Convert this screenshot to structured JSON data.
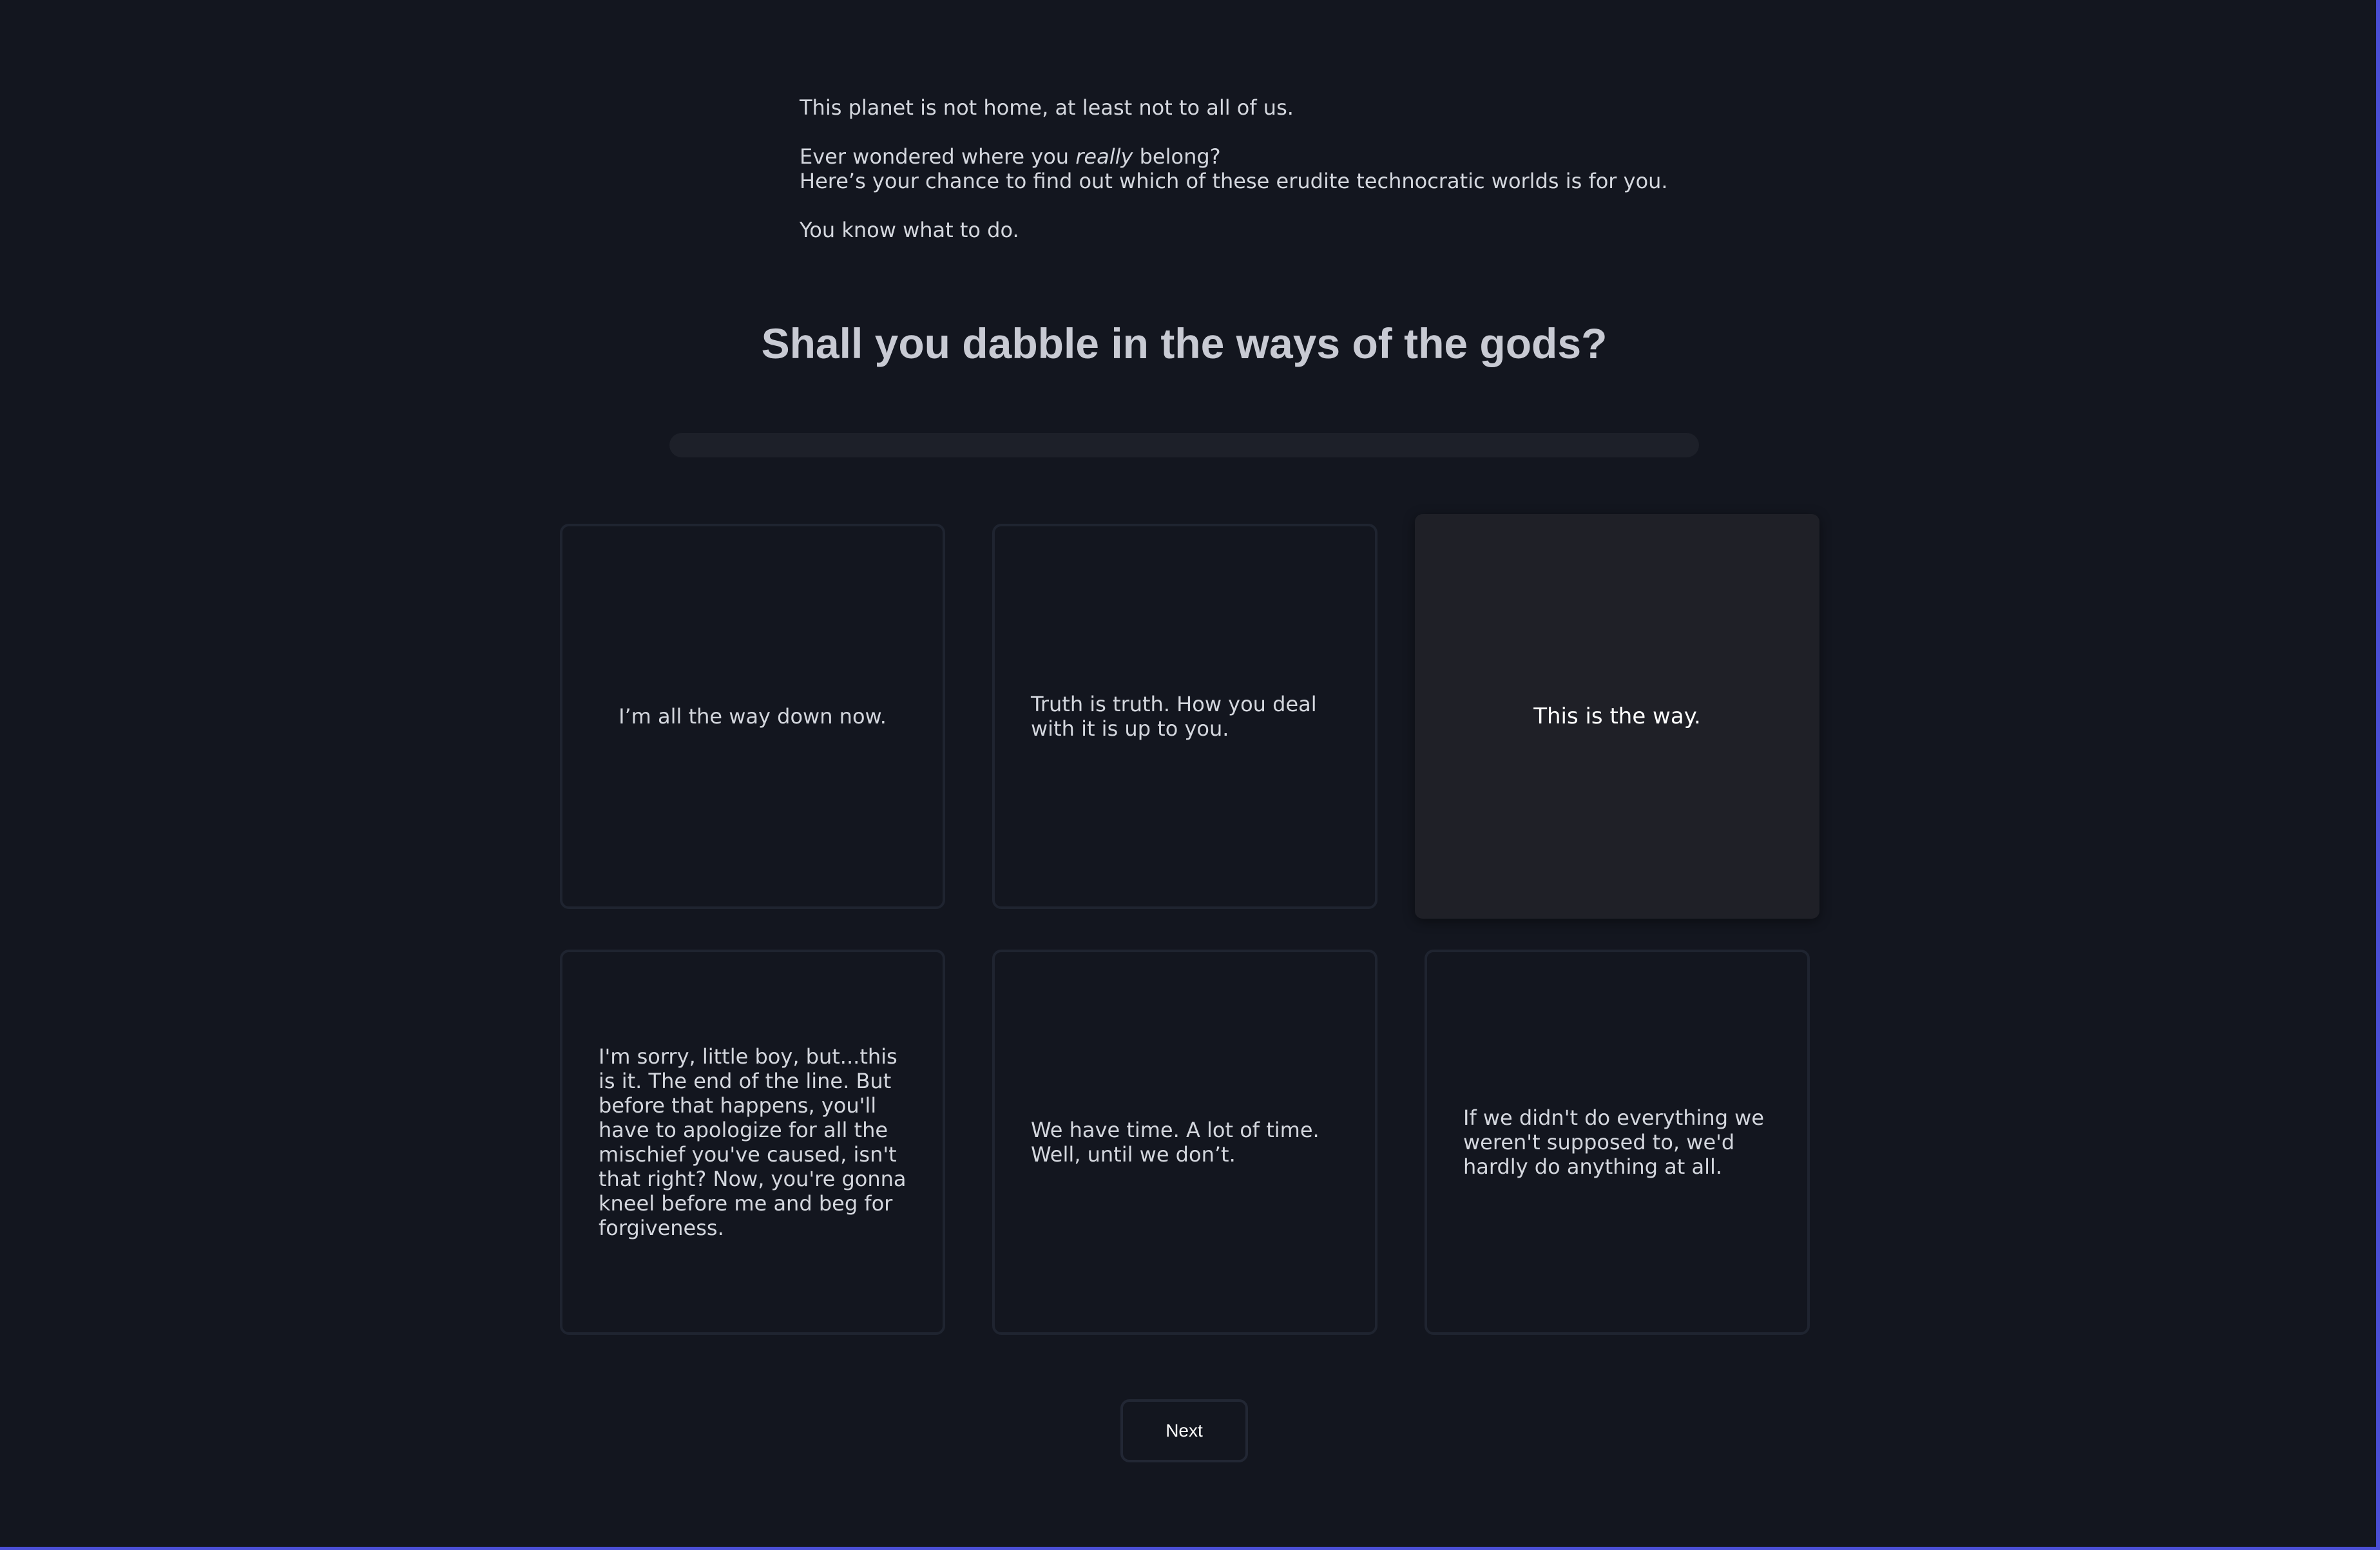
{
  "intro": {
    "line1": "This planet is not home, at least not to all of us.",
    "line2_before": "Ever wondered where you ",
    "line2_emphasis": "really",
    "line2_after": " belong?",
    "line3": "Here’s your chance to find out which of these erudite technocratic worlds is for you.",
    "line4": "You know what to do."
  },
  "question": {
    "title": "Shall you dabble in the ways of the gods?"
  },
  "progress": {
    "fraction": 0
  },
  "options": [
    {
      "text": "I’m all the way down now.",
      "selected": false
    },
    {
      "text": "Truth is truth. How you deal with it is up to you.",
      "selected": false
    },
    {
      "text": "This is the way.",
      "selected": true
    },
    {
      "text": "I'm sorry, little boy, but...this is it. The end of the line. But before that happens, you'll have to apologize for all the mischief you've caused, isn't that right? Now, you're gonna kneel before me and beg for forgiveness.",
      "selected": false
    },
    {
      "text": "We have time. A lot of time. Well, until we don’t.",
      "selected": false
    },
    {
      "text": "If we didn't do everything we weren't supposed to, we'd hardly do anything at all.",
      "selected": false
    }
  ],
  "actions": {
    "next_label": "Next"
  }
}
